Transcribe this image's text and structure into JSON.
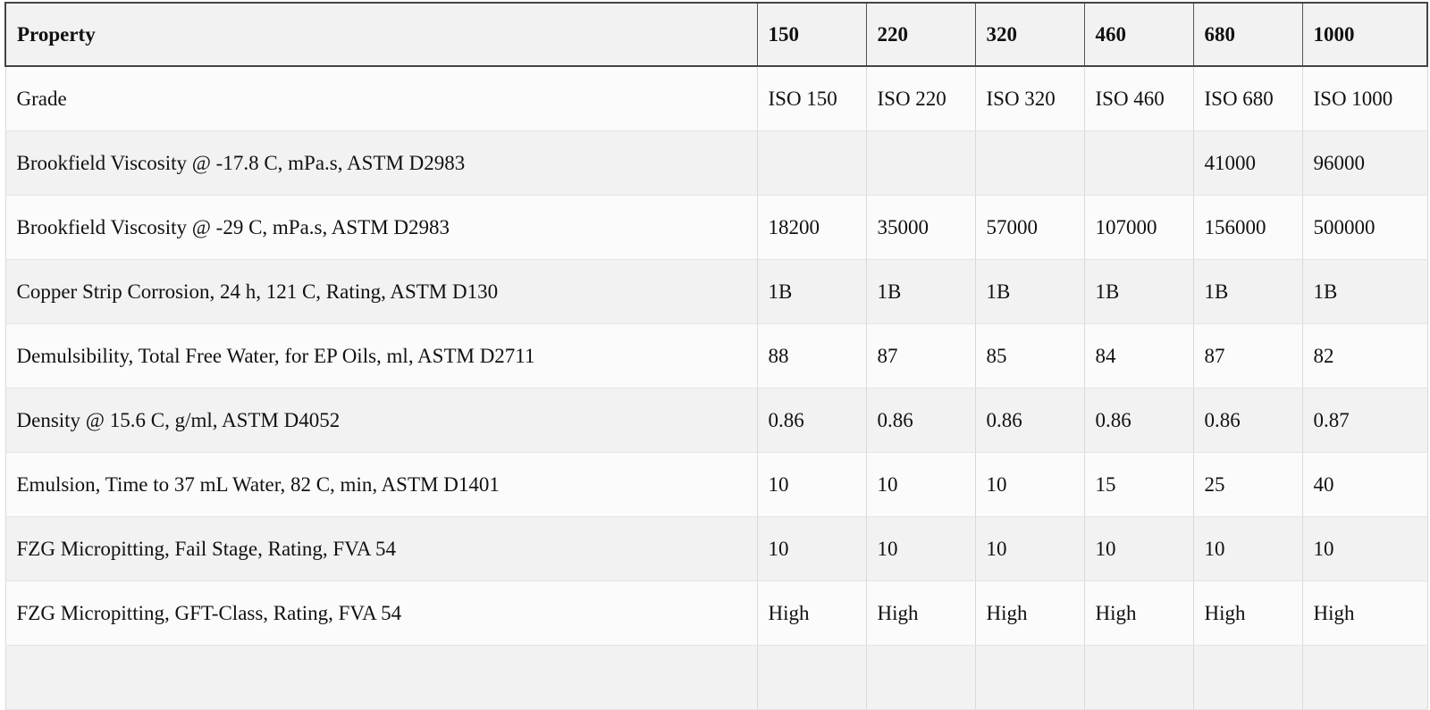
{
  "table": {
    "headers": [
      "Property",
      "150",
      "220",
      "320",
      "460",
      "680",
      "1000"
    ],
    "rows": [
      [
        "Grade",
        "ISO 150",
        "ISO 220",
        "ISO 320",
        "ISO 460",
        "ISO 680",
        "ISO 1000"
      ],
      [
        "Brookfield Viscosity @ -17.8 C, mPa.s, ASTM D2983",
        "",
        "",
        "",
        "",
        "41000",
        "96000"
      ],
      [
        "Brookfield Viscosity @ -29 C, mPa.s, ASTM D2983",
        "18200",
        "35000",
        "57000",
        "107000",
        "156000",
        "500000"
      ],
      [
        "Copper Strip Corrosion, 24 h, 121 C, Rating, ASTM D130",
        "1B",
        "1B",
        "1B",
        "1B",
        "1B",
        "1B"
      ],
      [
        "Demulsibility, Total Free Water, for EP Oils, ml, ASTM D2711",
        "88",
        "87",
        "85",
        "84",
        "87",
        "82"
      ],
      [
        "Density @ 15.6 C, g/ml, ASTM D4052",
        "0.86",
        "0.86",
        "0.86",
        "0.86",
        "0.86",
        "0.87"
      ],
      [
        "Emulsion, Time to 37 mL Water, 82 C, min, ASTM D1401",
        "10",
        "10",
        "10",
        "15",
        "25",
        "40"
      ],
      [
        "FZG Micropitting, Fail Stage, Rating, FVA 54",
        "10",
        "10",
        "10",
        "10",
        "10",
        "10"
      ],
      [
        "FZG Micropitting, GFT-Class, Rating, FVA 54",
        "High",
        "High",
        "High",
        "High",
        "High",
        "High"
      ],
      [
        "",
        "",
        "",
        "",
        "",
        "",
        ""
      ]
    ]
  }
}
